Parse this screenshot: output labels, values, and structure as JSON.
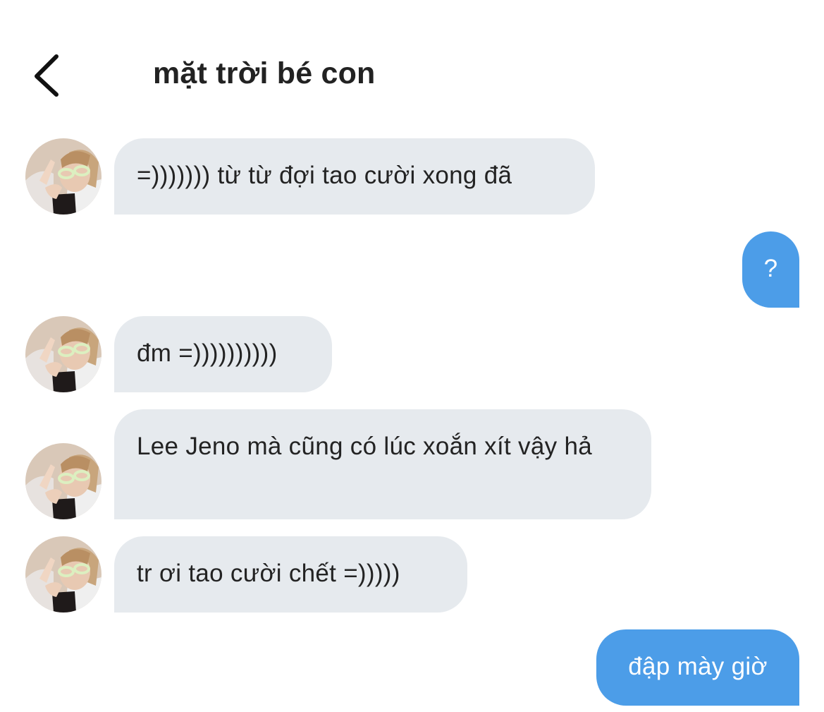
{
  "header": {
    "back_icon": "chevron-left-icon",
    "title": "mặt trời bé con"
  },
  "colors": {
    "incoming_bubble": "#e6eaee",
    "outgoing_bubble": "#4c9de8",
    "background": "#ffffff"
  },
  "messages": [
    {
      "direction": "incoming",
      "text": "=))))))) từ từ đợi tao cười xong đã"
    },
    {
      "direction": "outgoing",
      "text": "?"
    },
    {
      "direction": "incoming",
      "text": "đm =))))))))))"
    },
    {
      "direction": "incoming",
      "text": "Lee Jeno mà cũng có lúc xoắn xít vậy hả"
    },
    {
      "direction": "incoming",
      "text": "tr ơi tao cười chết =)))))"
    },
    {
      "direction": "outgoing",
      "text": "đập mày giờ"
    }
  ]
}
